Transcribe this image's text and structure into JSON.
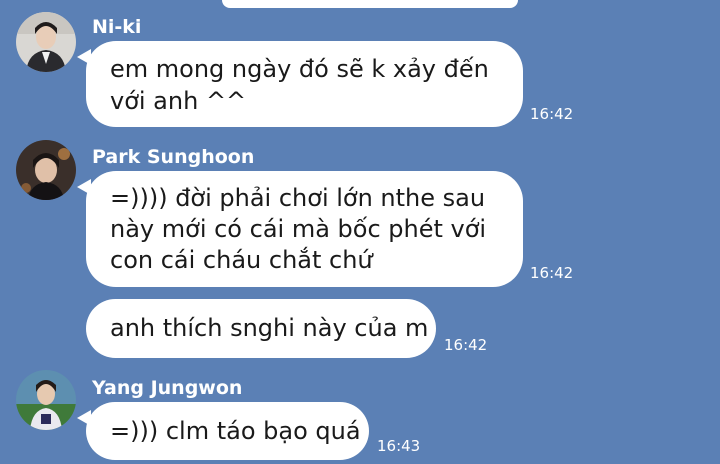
{
  "messages": [
    {
      "sender": "Ni-ki",
      "avatar_icon": "user-avatar-icon",
      "lines": [
        "em mong ngày đó sẽ k xảy đến",
        "với anh ^^"
      ],
      "time": "16:42"
    },
    {
      "sender": "Park Sunghoon",
      "avatar_icon": "user-avatar-icon",
      "lines": [
        "=)))) đời phải chơi lớn nthe sau",
        "này mới có cái mà bốc phét với",
        "con cái cháu chắt chứ"
      ],
      "time": "16:42"
    },
    {
      "sender": "Park Sunghoon",
      "lines": [
        "anh thích snghi này của m"
      ],
      "time": "16:42"
    },
    {
      "sender": "Yang Jungwon",
      "avatar_icon": "user-avatar-icon",
      "lines": [
        "=))) clm táo bạo quá"
      ],
      "time": "16:43"
    }
  ],
  "colors": {
    "background": "#5b80b5",
    "bubble": "#ffffff",
    "meta_text": "#ffffff"
  }
}
